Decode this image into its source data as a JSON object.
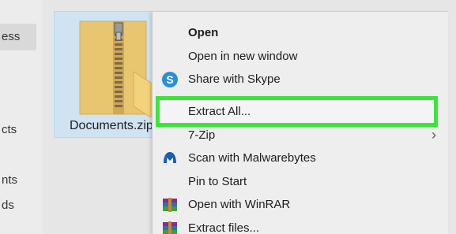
{
  "sidebar": {
    "items": [
      {
        "label": "ess",
        "active": true
      },
      {
        "label": "cts",
        "active": false
      },
      {
        "label": "nts",
        "active": false
      },
      {
        "label": "ds",
        "active": false
      }
    ]
  },
  "file": {
    "name": "Documents.zip",
    "icon": "zip-folder-icon"
  },
  "context_menu": {
    "items": [
      {
        "label": "Open",
        "bold": true,
        "icon": null
      },
      {
        "label": "Open in new window",
        "icon": null
      },
      {
        "label": "Share with Skype",
        "icon": "skype-icon"
      },
      {
        "label": "Extract All...",
        "highlighted": true,
        "icon": null
      },
      {
        "label": "7-Zip",
        "icon": null,
        "submenu": true
      },
      {
        "label": "Scan with Malwarebytes",
        "icon": "malwarebytes-icon"
      },
      {
        "label": "Pin to Start",
        "icon": null
      },
      {
        "label": "Open with WinRAR",
        "icon": "winrar-icon"
      },
      {
        "label": "Extract files...",
        "icon": "winrar-icon"
      }
    ],
    "submenu_glyph": "›",
    "skype_glyph": "S"
  },
  "colors": {
    "highlight_border": "#39e639",
    "selection_bg": "#cfe3f2",
    "menu_bg": "#eeeeee"
  }
}
